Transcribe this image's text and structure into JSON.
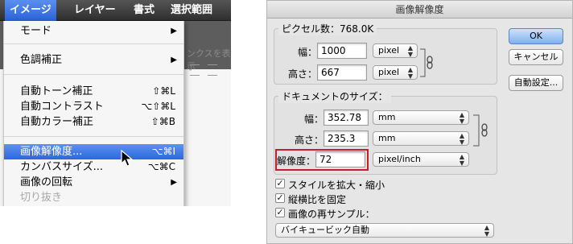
{
  "menubar": {
    "items": [
      "イメージ",
      "レイヤー",
      "書式",
      "選択範囲"
    ]
  },
  "toolbar_ghost": {
    "text": "ンクスを表示"
  },
  "menu": {
    "items": [
      {
        "label": "モード",
        "shortcut": "",
        "submenu": true
      },
      {
        "label": "色調補正",
        "shortcut": "",
        "submenu": true
      },
      {
        "label": "自動トーン補正",
        "shortcut": "⇧⌘L",
        "submenu": false
      },
      {
        "label": "自動コントラスト",
        "shortcut": "⌥⇧⌘L",
        "submenu": false
      },
      {
        "label": "自動カラー補正",
        "shortcut": "⇧⌘B",
        "submenu": false
      },
      {
        "label": "画像解像度...",
        "shortcut": "⌥⌘I",
        "submenu": false,
        "selected": true
      },
      {
        "label": "カンバスサイズ...",
        "shortcut": "⌥⌘C",
        "submenu": false
      },
      {
        "label": "画像の回転",
        "shortcut": "",
        "submenu": true
      },
      {
        "label": "切り抜き",
        "shortcut": "",
        "submenu": false,
        "disabled": true
      }
    ],
    "submenu_arrow": "▶",
    "selection_color": "#2d67dc"
  },
  "dialog": {
    "title": "画像解像度",
    "pixel_group": {
      "legend": "ピクセル数：768.0K",
      "width_label": "幅：",
      "width_value": "1000",
      "width_unit": "pixel",
      "height_label": "高さ：",
      "height_value": "667",
      "height_unit": "pixel"
    },
    "doc_group": {
      "legend": "ドキュメントのサイズ：",
      "width_label": "幅：",
      "width_value": "352.78",
      "width_unit": "mm",
      "height_label": "高さ：",
      "height_value": "235.3",
      "height_unit": "mm",
      "res_label": "解像度：",
      "res_value": "72",
      "res_unit": "pixel/inch"
    },
    "checkboxes": [
      {
        "label": "スタイルを拡大・縮小",
        "checked": true
      },
      {
        "label": "縦横比を固定",
        "checked": true
      },
      {
        "label": "画像の再サンプル：",
        "checked": true
      }
    ],
    "resample_method": "バイキュービック自動",
    "buttons": {
      "ok": "OK",
      "cancel": "キャンセル",
      "auto": "自動設定..."
    },
    "check_mark": "✓",
    "updown_glyph": "⌃⌄",
    "highlight_color": "#c41e2a"
  }
}
